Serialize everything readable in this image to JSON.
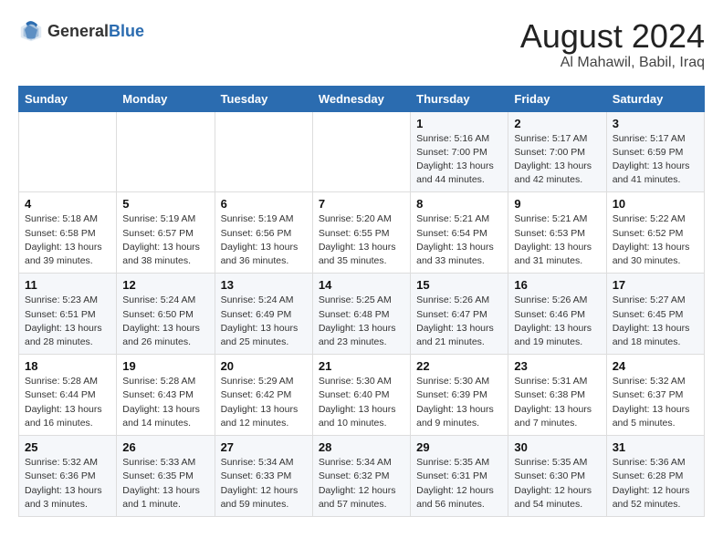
{
  "logo": {
    "text_general": "General",
    "text_blue": "Blue"
  },
  "title": "August 2024",
  "subtitle": "Al Mahawil, Babil, Iraq",
  "days_of_week": [
    "Sunday",
    "Monday",
    "Tuesday",
    "Wednesday",
    "Thursday",
    "Friday",
    "Saturday"
  ],
  "weeks": [
    [
      {
        "day": "",
        "info": ""
      },
      {
        "day": "",
        "info": ""
      },
      {
        "day": "",
        "info": ""
      },
      {
        "day": "",
        "info": ""
      },
      {
        "day": "1",
        "info": "Sunrise: 5:16 AM\nSunset: 7:00 PM\nDaylight: 13 hours\nand 44 minutes."
      },
      {
        "day": "2",
        "info": "Sunrise: 5:17 AM\nSunset: 7:00 PM\nDaylight: 13 hours\nand 42 minutes."
      },
      {
        "day": "3",
        "info": "Sunrise: 5:17 AM\nSunset: 6:59 PM\nDaylight: 13 hours\nand 41 minutes."
      }
    ],
    [
      {
        "day": "4",
        "info": "Sunrise: 5:18 AM\nSunset: 6:58 PM\nDaylight: 13 hours\nand 39 minutes."
      },
      {
        "day": "5",
        "info": "Sunrise: 5:19 AM\nSunset: 6:57 PM\nDaylight: 13 hours\nand 38 minutes."
      },
      {
        "day": "6",
        "info": "Sunrise: 5:19 AM\nSunset: 6:56 PM\nDaylight: 13 hours\nand 36 minutes."
      },
      {
        "day": "7",
        "info": "Sunrise: 5:20 AM\nSunset: 6:55 PM\nDaylight: 13 hours\nand 35 minutes."
      },
      {
        "day": "8",
        "info": "Sunrise: 5:21 AM\nSunset: 6:54 PM\nDaylight: 13 hours\nand 33 minutes."
      },
      {
        "day": "9",
        "info": "Sunrise: 5:21 AM\nSunset: 6:53 PM\nDaylight: 13 hours\nand 31 minutes."
      },
      {
        "day": "10",
        "info": "Sunrise: 5:22 AM\nSunset: 6:52 PM\nDaylight: 13 hours\nand 30 minutes."
      }
    ],
    [
      {
        "day": "11",
        "info": "Sunrise: 5:23 AM\nSunset: 6:51 PM\nDaylight: 13 hours\nand 28 minutes."
      },
      {
        "day": "12",
        "info": "Sunrise: 5:24 AM\nSunset: 6:50 PM\nDaylight: 13 hours\nand 26 minutes."
      },
      {
        "day": "13",
        "info": "Sunrise: 5:24 AM\nSunset: 6:49 PM\nDaylight: 13 hours\nand 25 minutes."
      },
      {
        "day": "14",
        "info": "Sunrise: 5:25 AM\nSunset: 6:48 PM\nDaylight: 13 hours\nand 23 minutes."
      },
      {
        "day": "15",
        "info": "Sunrise: 5:26 AM\nSunset: 6:47 PM\nDaylight: 13 hours\nand 21 minutes."
      },
      {
        "day": "16",
        "info": "Sunrise: 5:26 AM\nSunset: 6:46 PM\nDaylight: 13 hours\nand 19 minutes."
      },
      {
        "day": "17",
        "info": "Sunrise: 5:27 AM\nSunset: 6:45 PM\nDaylight: 13 hours\nand 18 minutes."
      }
    ],
    [
      {
        "day": "18",
        "info": "Sunrise: 5:28 AM\nSunset: 6:44 PM\nDaylight: 13 hours\nand 16 minutes."
      },
      {
        "day": "19",
        "info": "Sunrise: 5:28 AM\nSunset: 6:43 PM\nDaylight: 13 hours\nand 14 minutes."
      },
      {
        "day": "20",
        "info": "Sunrise: 5:29 AM\nSunset: 6:42 PM\nDaylight: 13 hours\nand 12 minutes."
      },
      {
        "day": "21",
        "info": "Sunrise: 5:30 AM\nSunset: 6:40 PM\nDaylight: 13 hours\nand 10 minutes."
      },
      {
        "day": "22",
        "info": "Sunrise: 5:30 AM\nSunset: 6:39 PM\nDaylight: 13 hours\nand 9 minutes."
      },
      {
        "day": "23",
        "info": "Sunrise: 5:31 AM\nSunset: 6:38 PM\nDaylight: 13 hours\nand 7 minutes."
      },
      {
        "day": "24",
        "info": "Sunrise: 5:32 AM\nSunset: 6:37 PM\nDaylight: 13 hours\nand 5 minutes."
      }
    ],
    [
      {
        "day": "25",
        "info": "Sunrise: 5:32 AM\nSunset: 6:36 PM\nDaylight: 13 hours\nand 3 minutes."
      },
      {
        "day": "26",
        "info": "Sunrise: 5:33 AM\nSunset: 6:35 PM\nDaylight: 13 hours\nand 1 minute."
      },
      {
        "day": "27",
        "info": "Sunrise: 5:34 AM\nSunset: 6:33 PM\nDaylight: 12 hours\nand 59 minutes."
      },
      {
        "day": "28",
        "info": "Sunrise: 5:34 AM\nSunset: 6:32 PM\nDaylight: 12 hours\nand 57 minutes."
      },
      {
        "day": "29",
        "info": "Sunrise: 5:35 AM\nSunset: 6:31 PM\nDaylight: 12 hours\nand 56 minutes."
      },
      {
        "day": "30",
        "info": "Sunrise: 5:35 AM\nSunset: 6:30 PM\nDaylight: 12 hours\nand 54 minutes."
      },
      {
        "day": "31",
        "info": "Sunrise: 5:36 AM\nSunset: 6:28 PM\nDaylight: 12 hours\nand 52 minutes."
      }
    ]
  ]
}
